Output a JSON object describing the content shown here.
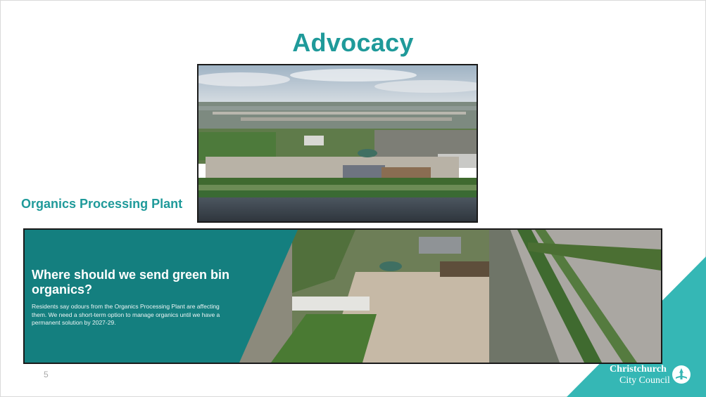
{
  "slide": {
    "title": "Advocacy",
    "subtitle": "Organics Processing Plant",
    "page_number": "5"
  },
  "banner": {
    "heading": "Where should we send green bin organics?",
    "body": "Residents say odours from the Organics Processing Plant are affecting them. We need a short-term option to manage organics until we have a permanent solution by 2027-29."
  },
  "logo": {
    "line1": "Christchurch",
    "line2": "City Council"
  },
  "colors": {
    "accent": "#1f9a9a",
    "banner_panel": "#147f7f",
    "corner_triangle": "#35b7b5"
  }
}
